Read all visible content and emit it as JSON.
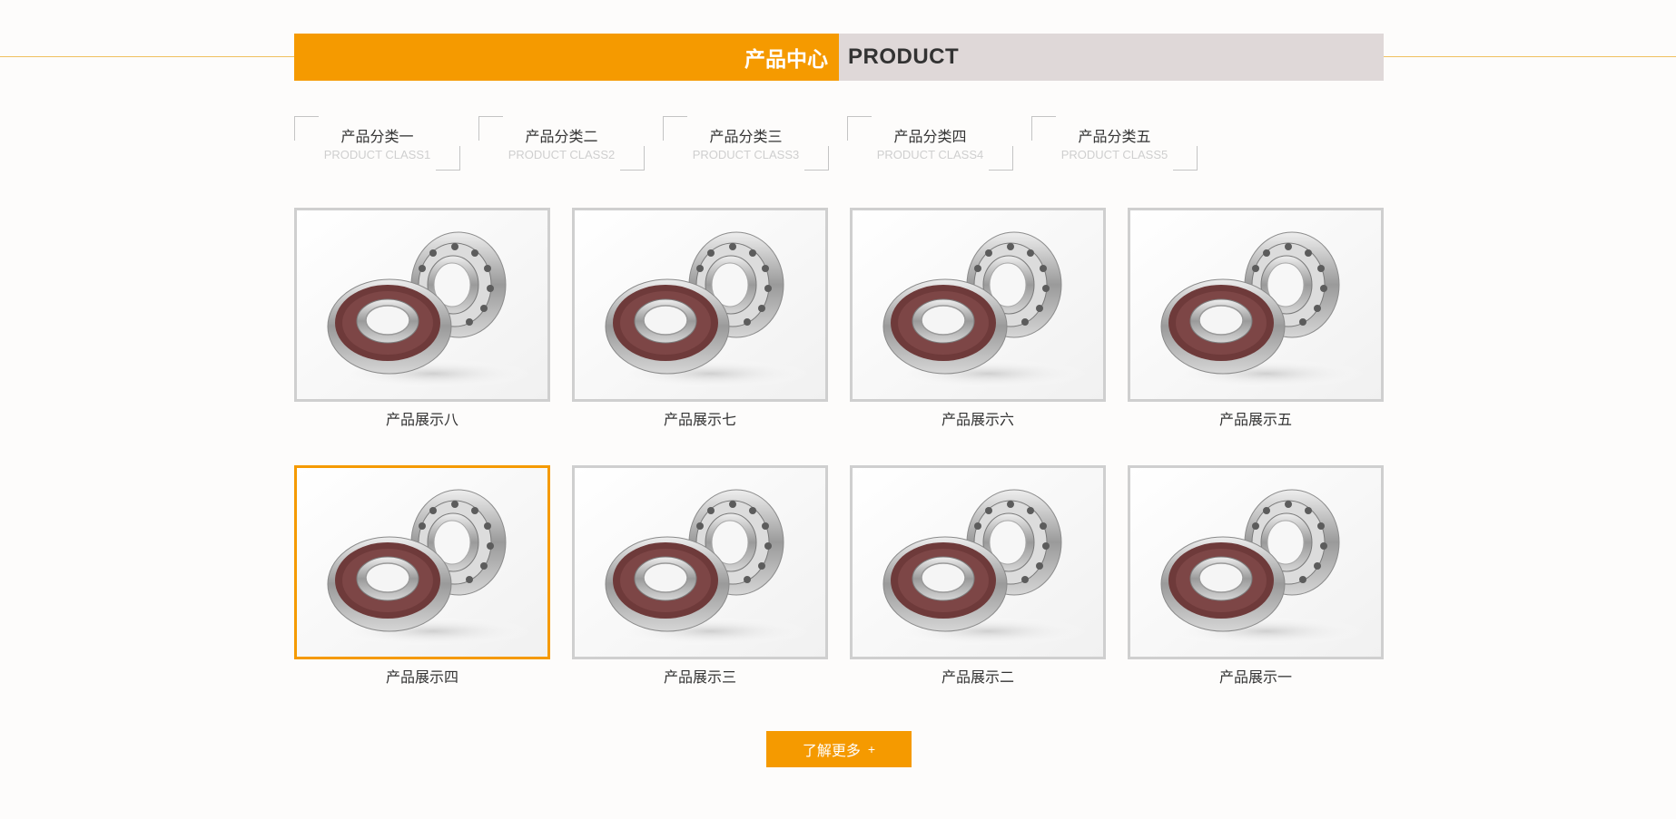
{
  "header": {
    "title_cn": "产品中心",
    "title_en": "PRODUCT",
    "accent_color": "#f59a00"
  },
  "categories": [
    {
      "cn": "产品分类一",
      "en": "PRODUCT CLASS1"
    },
    {
      "cn": "产品分类二",
      "en": "PRODUCT CLASS2"
    },
    {
      "cn": "产品分类三",
      "en": "PRODUCT CLASS3"
    },
    {
      "cn": "产品分类四",
      "en": "PRODUCT CLASS4"
    },
    {
      "cn": "产品分类五",
      "en": "PRODUCT CLASS5"
    }
  ],
  "products": [
    {
      "name": "产品展示八",
      "image": "ball-bearing-photo"
    },
    {
      "name": "产品展示七",
      "image": "ball-bearing-photo"
    },
    {
      "name": "产品展示六",
      "image": "ball-bearing-photo"
    },
    {
      "name": "产品展示五",
      "image": "ball-bearing-photo"
    },
    {
      "name": "产品展示四",
      "image": "ball-bearing-photo",
      "highlighted": true
    },
    {
      "name": "产品展示三",
      "image": "ball-bearing-photo"
    },
    {
      "name": "产品展示二",
      "image": "ball-bearing-photo"
    },
    {
      "name": "产品展示一",
      "image": "ball-bearing-photo"
    }
  ],
  "more_button": {
    "label": "了解更多",
    "icon": "+"
  }
}
